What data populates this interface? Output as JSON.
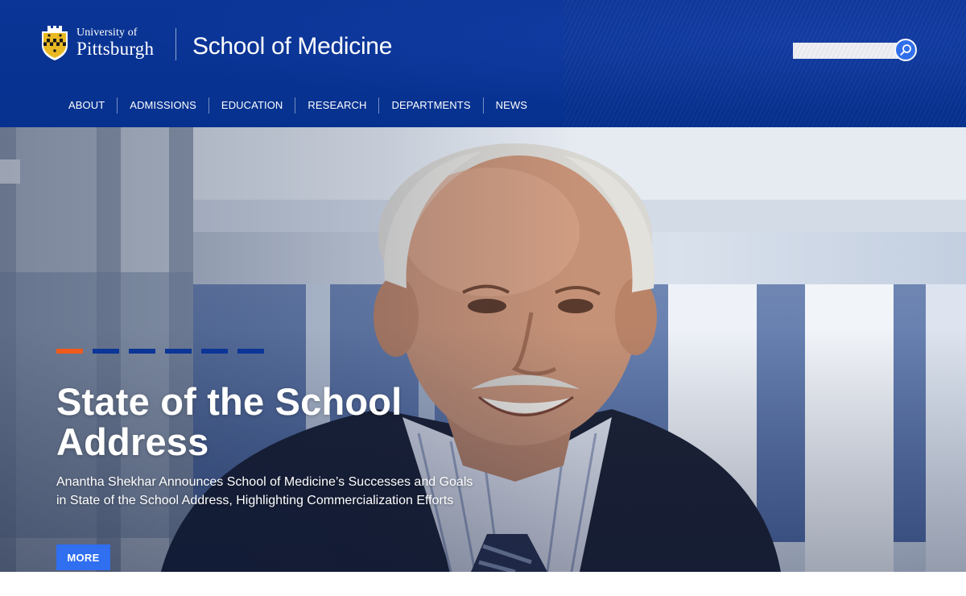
{
  "header": {
    "university_line1": "University of",
    "university_line2": "Pittsburgh",
    "school_name": "School of Medicine",
    "search": {
      "placeholder": "",
      "value": ""
    }
  },
  "nav": {
    "items": [
      {
        "label": "ABOUT"
      },
      {
        "label": "ADMISSIONS"
      },
      {
        "label": "EDUCATION"
      },
      {
        "label": "RESEARCH"
      },
      {
        "label": "DEPARTMENTS"
      },
      {
        "label": "NEWS"
      }
    ]
  },
  "hero": {
    "title": "State of the School Address",
    "subtitle": "Anantha Shekhar Announces School of Medicine’s Successes and Goals in State of the School Address, Highlighting Commercialization Efforts",
    "more_label": "MORE",
    "slides_count": 6,
    "active_slide": 1
  },
  "colors": {
    "header_blue": "#06318f",
    "accent_orange": "#f05a1c",
    "button_blue": "#2f6ff0",
    "crest_gold": "#e8b923"
  },
  "icons": {
    "search": "search-icon",
    "crest": "pitt-crest-logo"
  }
}
